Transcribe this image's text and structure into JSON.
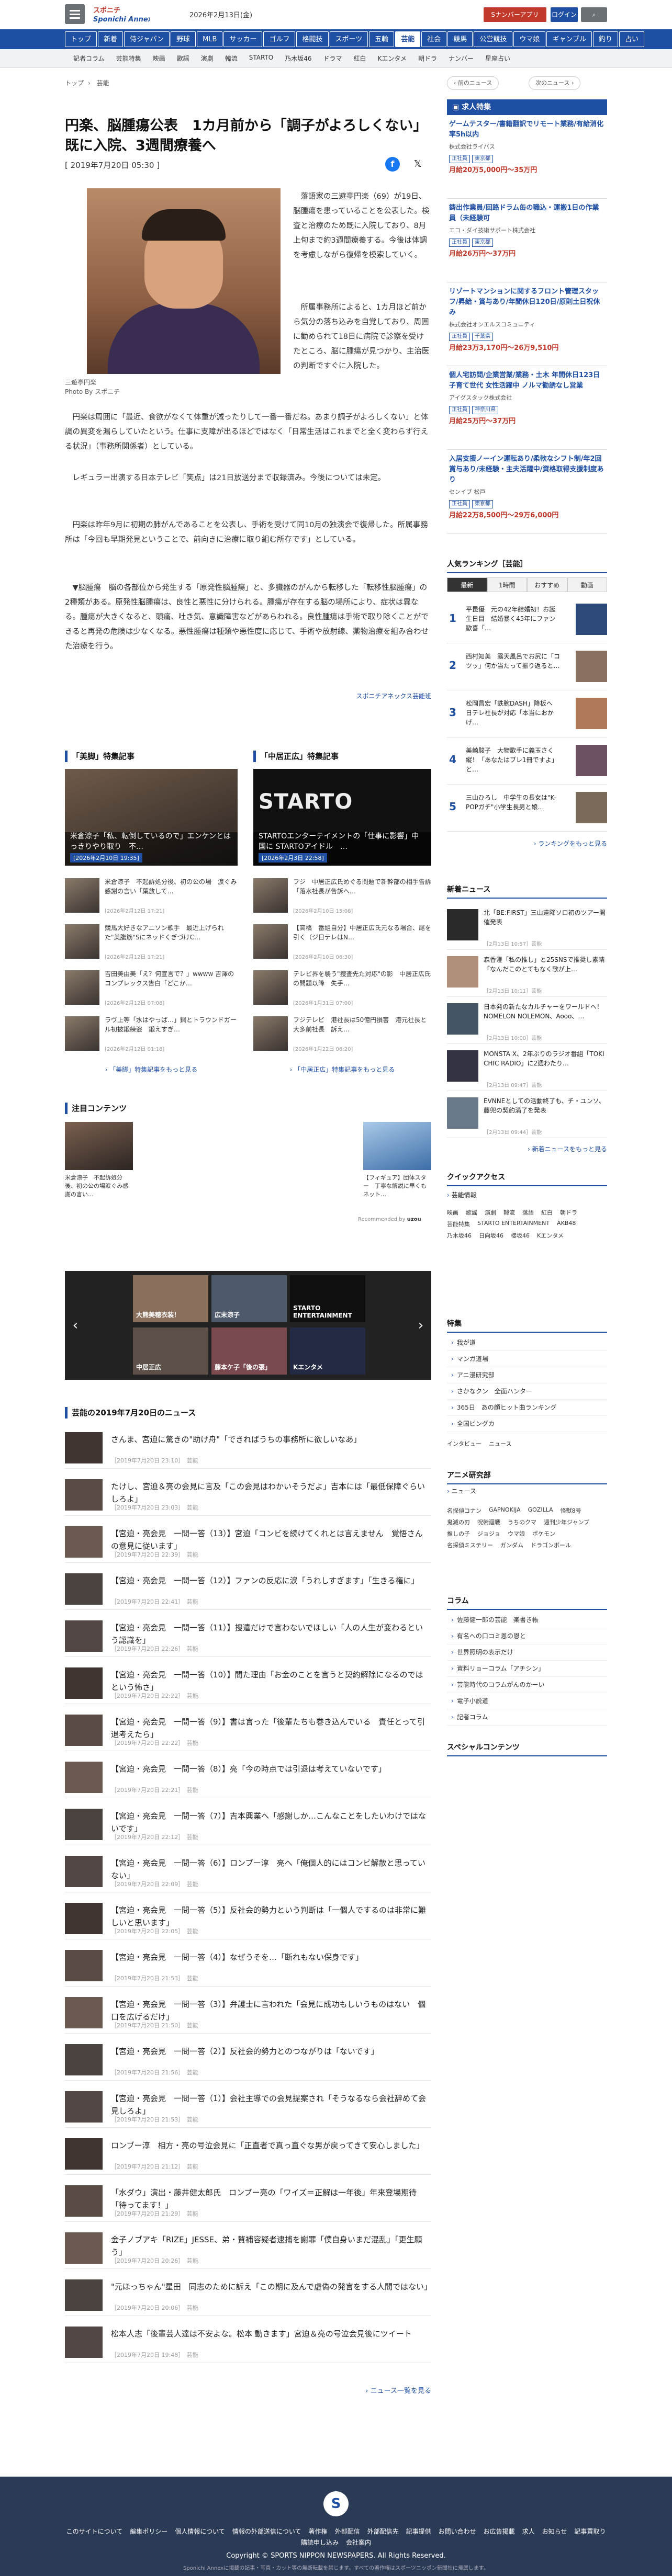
{
  "header": {
    "date": "2026年2月13日(金)",
    "btn_app": "Sナンバーアプリ",
    "btn_login": "ログイン",
    "btn_search": "検索"
  },
  "colors": {
    "brand": "#1f4fa3",
    "accent": "#c0392b",
    "footer": "#2b3a55"
  },
  "gnav": [
    "トップ",
    "新着",
    "侍ジャパン",
    "野球",
    "MLB",
    "サッカー",
    "ゴルフ",
    "格闘技",
    "スポーツ",
    "五輪",
    "芸能",
    "社会",
    "競馬",
    "公営競技",
    "ウマ娘",
    "ギャンブル",
    "釣り",
    "占い"
  ],
  "gnav_active": "芸能",
  "snav": [
    "記者コラム",
    "芸能特集",
    "映画",
    "歌謡",
    "演劇",
    "韓流",
    "STARTO",
    "乃木坂46",
    "ドラマ",
    "紅白",
    "Kエンタメ",
    "朝ドラ",
    "ナンバー",
    "星座占い"
  ],
  "breadcrumb": [
    "トップ",
    "芸能"
  ],
  "pagenav": {
    "prev": "前のニュース",
    "next": "次のニュース"
  },
  "article": {
    "title": "円楽、脳腫瘍公表　1カ月前から「調子がよろしくない」　既に入院、3週間療養へ",
    "date": "[ 2019年7月20日 05:30 ]",
    "photo_caption": "三遊亭円楽",
    "photo_credit": "Photo By スポニチ",
    "lead_1": "　落語家の三遊亭円楽（69）が19日、脳腫瘍を患っていることを公表した。検査と治療のため既に入院しており、8月上旬まで約3週間療養する。今後は体調を考慮しながら復帰を模索していく。",
    "lead_2": "　所属事務所によると、1カ月ほど前から気分の落ち込みを自覚しており、周囲に勧められて18日に病院で診察を受けたところ、脳に腫瘍が見つかり、主治医の判断ですぐに入院した。",
    "p1": "　円楽は周囲に「最近、食欲がなくて体重が減ったりして一番一番だね。あまり調子がよろしくない」と体調の異変を漏らしていたという。仕事に支障が出るほどではなく「日常生活はこれまでと全く変わらず行える状況」（事務所関係者）としている。",
    "p2": "　レギュラー出演する日本テレビ「笑点」は21日放送分まで収録済み。今後については未定。",
    "p3": "　円楽は昨年9月に初期の肺がんであることを公表し、手術を受けて同10月の独演会で復帰した。所属事務所は「今回も早期発見ということで、前向きに治療に取り組む所存です」としている。",
    "p4": "　▼脳腫瘍　脳の各部位から発生する「原発性脳腫瘍」と、多臓器のがんから転移した「転移性脳腫瘍」の2種類がある。原発性脳腫瘍は、良性と悪性に分けられる。腫瘍が存在する脳の場所により、症状は異なる。腫瘍が大きくなると、頭痛、吐き気、意識障害などがあらわれる。良性腫瘍は手術で取り除くことができると再発の危険は少なくなる。悪性腫瘍は種類や悪性度に応じて、手術や放射線、薬物治療を組み合わせた治療を行う。",
    "source": "スポニチアネックス芸能班"
  },
  "special_left": {
    "title": "「美脚」特集記事",
    "main_caption": "米倉涼子「私、転倒しているので」エンケンとはっきりやり取り　不…",
    "main_date": "[2026年2月10日 19:35]",
    "items": [
      {
        "text": "米倉涼子　不起訴処分後、初の公の場　涙ぐみ感謝の言い「葉放して…",
        "date": "[2026年2月12日 17:21]"
      },
      {
        "text": "競馬大好きなアニソン歌手　最近上げられた\"美腹筋\"SにネッドくぎづけC…",
        "date": "[2026年2月12日 17:21]"
      },
      {
        "text": "吉田美由美「え？何宣言で？」wwww 吉澤のコンプレックス告白「どこか…",
        "date": "[2026年2月12日 07:08]"
      },
      {
        "text": "ラヴ上等「水はやっぱ…」鋼とトラウンドガール初披鍛練姿　鍛えすぎ…",
        "date": "[2026年2月12日 01:18]"
      }
    ],
    "more": "「美脚」特集記事をもっと見る"
  },
  "special_right": {
    "title": "「中居正広」特集記事",
    "main_caption": "STARTOエンターテイメントの「仕事に影響」中国に STARTOアイドル　…",
    "main_date": "[2026年2月3日 22:58]",
    "items": [
      {
        "text": "フジ　中居正広氏めぐる問題で新幹部の相手告訴　「落水社長が告訴へ…",
        "date": "[2026年2月10日 15:08]"
      },
      {
        "text": "【高橋　番組自分】中居正広氏元なる場合、尾を引く（ジ日テレはN…",
        "date": "[2026年2月10日 06:30]"
      },
      {
        "text": "テレビ界を襲う\"捜査先た対応\"の影　中居正広氏の問題以降　失手…",
        "date": "[2026年1月31日 07:00]"
      },
      {
        "text": "フジテレビ　港社長は50億円損害　港元社長と大多前社長　訴え…",
        "date": "[2026年1月22日 06:20]"
      }
    ],
    "more": "「中居正広」特集記事をもっと見る"
  },
  "focus": {
    "title": "注目コンテンツ",
    "left_text": "米倉涼子　不起訴処分後、初の公の場涙ぐみ感謝の言い…",
    "right_text": "【フィギュア】団体スター　丁寧な解説に早くもネット…",
    "recommended": "Recommended by"
  },
  "carousel": [
    {
      "label": "大熊美穂衣装！"
    },
    {
      "label": "広末涼子"
    },
    {
      "label": "STARTO ENTERTAINMENT"
    },
    {
      "label": "中居正広"
    },
    {
      "label": "藤本ケ子「後の張」"
    },
    {
      "label": "Kエンタメ"
    }
  ],
  "daily": {
    "title": "芸能の2019年7月20日のニュース",
    "items": [
      {
        "title": "さんま、宮迫に驚きの\"助け舟\"「できればうちの事務所に欲しいなあ」",
        "meta": "［2019年7月20日 23:10］　芸能"
      },
      {
        "title": "たけし、宮迫＆亮の会見に言及「この会見はわかいそうだよ」吉本には「最低保障ぐらいしろよ」",
        "meta": "［2019年7月20日 23:03］　芸能"
      },
      {
        "title": "【宮迫・亮会見　一問一答（13）】宮迫「コンビを続けてくれとは言えません　覚悟さんの意見に従います」",
        "meta": "［2019年7月20日 22:39］　芸能"
      },
      {
        "title": "【宮迫・亮会見　一問一答（12）】ファンの反応に涙「うれしすぎます」「生きる権に」",
        "meta": "［2019年7月20日 22:41］　芸能"
      },
      {
        "title": "【宮迫・亮会見　一問一答（11）】捜遣だけで言わないでほしい「人の人生が変わるという認識を」",
        "meta": "［2019年7月20日 22:26］　芸能"
      },
      {
        "title": "【宮迫・亮会見　一問一答（10）】間た理由「お金のことを言うと契約解除になるのではという怖さ」",
        "meta": "［2019年7月20日 22:22］　芸能"
      },
      {
        "title": "【宮迫・亮会見　一問一答（9）】書は言った「後輩たちも巻き込んでいる　責任とって引退考えたら」",
        "meta": "［2019年7月20日 22:22］　芸能"
      },
      {
        "title": "【宮迫・亮会見　一問一答（8）】亮「今の時点では引退は考えていないです」",
        "meta": "［2019年7月20日 22:21］　芸能"
      },
      {
        "title": "【宮迫・亮会見　一問一答（7）】吉本興業へ「感謝しか…こんなことをしたいわけではないです」",
        "meta": "［2019年7月20日 22:12］　芸能"
      },
      {
        "title": "【宮迫・亮会見　一問一答（6）】ロンブー淳　亮へ「俺個人的にはコンビ解散と思っていない」",
        "meta": "［2019年7月20日 22:09］　芸能"
      },
      {
        "title": "【宮迫・亮会見　一問一答（5）】反社会的勢力という判断は「一個人でするのは非常に難しいと思います」",
        "meta": "［2019年7月20日 22:05］　芸能"
      },
      {
        "title": "【宮迫・亮会見　一問一答（4）】なぜうそを…「断れもない保身です」",
        "meta": "［2019年7月20日 21:53］　芸能"
      },
      {
        "title": "【宮迫・亮会見　一問一答（3）】弁護士に言われた「会見に成功もしいうものはない　個口を広げるだけ」",
        "meta": "［2019年7月20日 21:50］　芸能"
      },
      {
        "title": "【宮迫・亮会見　一問一答（2）】反社会的勢力とのつながりは「ないです」",
        "meta": "［2019年7月20日 21:56］　芸能"
      },
      {
        "title": "【宮迫・亮会見　一問一答（1）】会社主導での会見提案され「そうなるなら会社辞めて会見しろよ」",
        "meta": "［2019年7月20日 21:53］　芸能"
      },
      {
        "title": "ロンブー淳　相方・亮の号泣会見に「正直者で真っ直ぐな男が戻ってきて安心しました」",
        "meta": "［2019年7月20日 21:12］　芸能"
      },
      {
        "title": "「水ダウ」演出・藤井健太郎氏　ロンブー亮の「ワイズ＝正解は一年後」年来登場期待「待ってます！」",
        "meta": "［2019年7月20日 21:29］　芸能"
      },
      {
        "title": "金子ノブアキ「RIZE」JESSE、弟・贅補容疑者逮捕を謝罪「僕自身いまだ混乱」「更生願う」",
        "meta": "［2019年7月20日 20:26］　芸能"
      },
      {
        "title": "\"元ほっちゃん\"星田　同志のために訴え「この期に及んで虚偽の発言をする人間ではない」",
        "meta": "［2019年7月20日 20:06］　芸能"
      },
      {
        "title": "松本人志「後輩芸人達は不安よな。松本 動きます」宮迫＆亮の号泣会見後にツイート",
        "meta": "［2019年7月20日 19:48］　芸能"
      }
    ],
    "more": "ニュース一覧を見る"
  },
  "jobs": {
    "title": "求人特集",
    "items": [
      {
        "title": "ゲームテスター/書籍翻訳でリモート業務/有給消化率5h以内",
        "company": "株式会社ライパス",
        "tags": [
          "正社員",
          "東京都"
        ],
        "pay": "月給20万5,000円〜35万円"
      },
      {
        "title": "鋳出作業員/回路ドラム缶の職込・運搬1日の作業員（未経験可",
        "company": "エコ・ダイ技術サポート株式会社",
        "tags": [
          "正社員",
          "東京都"
        ],
        "pay": "月給26万円〜37万円"
      },
      {
        "title": "リゾートマンションに関するフロント管理スタッフ/昇給・賞与あり/年間休日120日/原則土日祝休み",
        "company": "株式会社オンエルスコミュニティ",
        "tags": [
          "正社員",
          "千葉県"
        ],
        "pay": "月給23万3,170円〜26万9,510円"
      },
      {
        "title": "個人宅訪問/企業営業/業務・土木 年間休日123日 子育て世代 女性活躍中 ノルマ勧誘なし営業",
        "company": "アイグスタック株式会社",
        "tags": [
          "正社員",
          "神奈川県"
        ],
        "pay": "月給25万円〜37万円"
      },
      {
        "title": "入居支援ノーイン運転あり/柔軟なシフト制/年2回賞与あり/未経験・主夫活躍中/資格取得支援制度あり",
        "company": "センイブ 松戸",
        "tags": [
          "正社員",
          "東京都"
        ],
        "pay": "月給22万8,500円〜29万6,000円"
      }
    ]
  },
  "ranking": {
    "title": "人気ランキング［芸能］",
    "tabs": [
      "最新",
      "1時間",
      "おすすめ",
      "動画"
    ],
    "items": [
      {
        "n": "1",
        "text": "平昆優　元の42年結婚初！お誕生日目　結婚暴く45年にファン歓喜「…"
      },
      {
        "n": "2",
        "text": "西村知美　露天風呂でお尻に「コツッ」何か当たって振り返ると…"
      },
      {
        "n": "3",
        "text": "松岡昌宏「鉄腕DASH」降板へ　日テレ社長が対応「本当におかげ…"
      },
      {
        "n": "4",
        "text": "美崎駿子　大物歌手に義玉さく縦！「あなたはブレ1冊ですよ」と…"
      },
      {
        "n": "5",
        "text": "三山ひろし　中学生の長女は\"K-POPガチ\"小学生長男と娘…"
      }
    ],
    "more": "ランキングをもっと見る"
  },
  "latest": {
    "title": "新着ニュース",
    "items": [
      {
        "text": "北「BE:FIRST」三山遠降ソロ初のツアー開催発表",
        "date": "［2月13日 10:57］芸能"
      },
      {
        "text": "森香澄「私の推し」と25SNSで推奨し素晴「なんだこのとてもなく歌が上…",
        "date": "［2月13日 10:11］芸能"
      },
      {
        "text": "日本発の新たなカルチャーをワールドへ！NOMELON NOLEMON、Aooo、…",
        "date": "［2月13日 10:00］芸能"
      },
      {
        "text": "MONSTA X、2年ぶりのラジオ番組「TOKI CHIC RADIO」に2週わたり…",
        "date": "［2月13日 09:47］芸能"
      },
      {
        "text": "EVNNEとしての活動終了も、チ・ユンソ、藤兜の契約満了を発表",
        "date": "［2月13日 09:44］芸能"
      }
    ],
    "more": "新着ニュースをもっと見る"
  },
  "quick": {
    "title": "クイックアクセス",
    "sub": "芸能情報",
    "chips": [
      "映画",
      "歌謡",
      "演劇",
      "韓流",
      "落語",
      "紅白",
      "朝ドラ",
      "芸能特集",
      "STARTO ENTERTAINMENT",
      "AKB48",
      "乃木坂46",
      "日向坂46",
      "櫻坂46",
      "Kエンタメ"
    ]
  },
  "tokushu": {
    "title": "特集",
    "items": [
      "我が道",
      "マンガ道場",
      "アニ漫研究部",
      "さかなクン　全面ハンター",
      "365日　あの顔ヒット曲ランキング",
      "全国ビングカ"
    ],
    "extra": [
      "インタビュー",
      "ニュース"
    ]
  },
  "anime": {
    "title": "アニメ研究部",
    "sub": "ニュース",
    "chips": [
      "名探偵コナン",
      "GAPNOKIJA",
      "GOZILLA",
      "怪獣8号",
      "鬼滅の刃",
      "呪術廻戦",
      "うちのクマ",
      "週刊少年ジャンプ",
      "推しの子",
      "ジョジョ",
      "ウマ娘",
      "ポケモン",
      "名探偵ミステリー",
      "ガンダム",
      "ドラゴンボール"
    ]
  },
  "column": {
    "title": "コラム",
    "items": [
      "佐藤健一郎の芸能　楽書き帳",
      "有名への口コミ恩の恩と",
      "世界照明の表示だけ",
      "資料リョーコラム「アチシン」",
      "芸能時代のコラムがんのかーい",
      "電子小説道",
      "記者コラム"
    ]
  },
  "special_content": {
    "title": "スペシャルコンテンツ"
  },
  "footer": {
    "links": [
      "このサイトについて",
      "編集ポリシー",
      "個人情報について",
      "情報の外部送信について",
      "著作権",
      "外部配信",
      "外部配信先",
      "記事提供",
      "お問い合わせ",
      "お広告掲載",
      "求人",
      "お知らせ",
      "記事買取り",
      "購読申し込み",
      "会社案内"
    ],
    "copyright": "Copyright © SPORTS NIPPON NEWSPAPERS. All Rights Reserved.",
    "note": "Sponichi Annexに掲載の記事・写真・カット等の無断転載を禁じます。すべての著作権はスポーツニッポン新聞社に帰属します。"
  }
}
